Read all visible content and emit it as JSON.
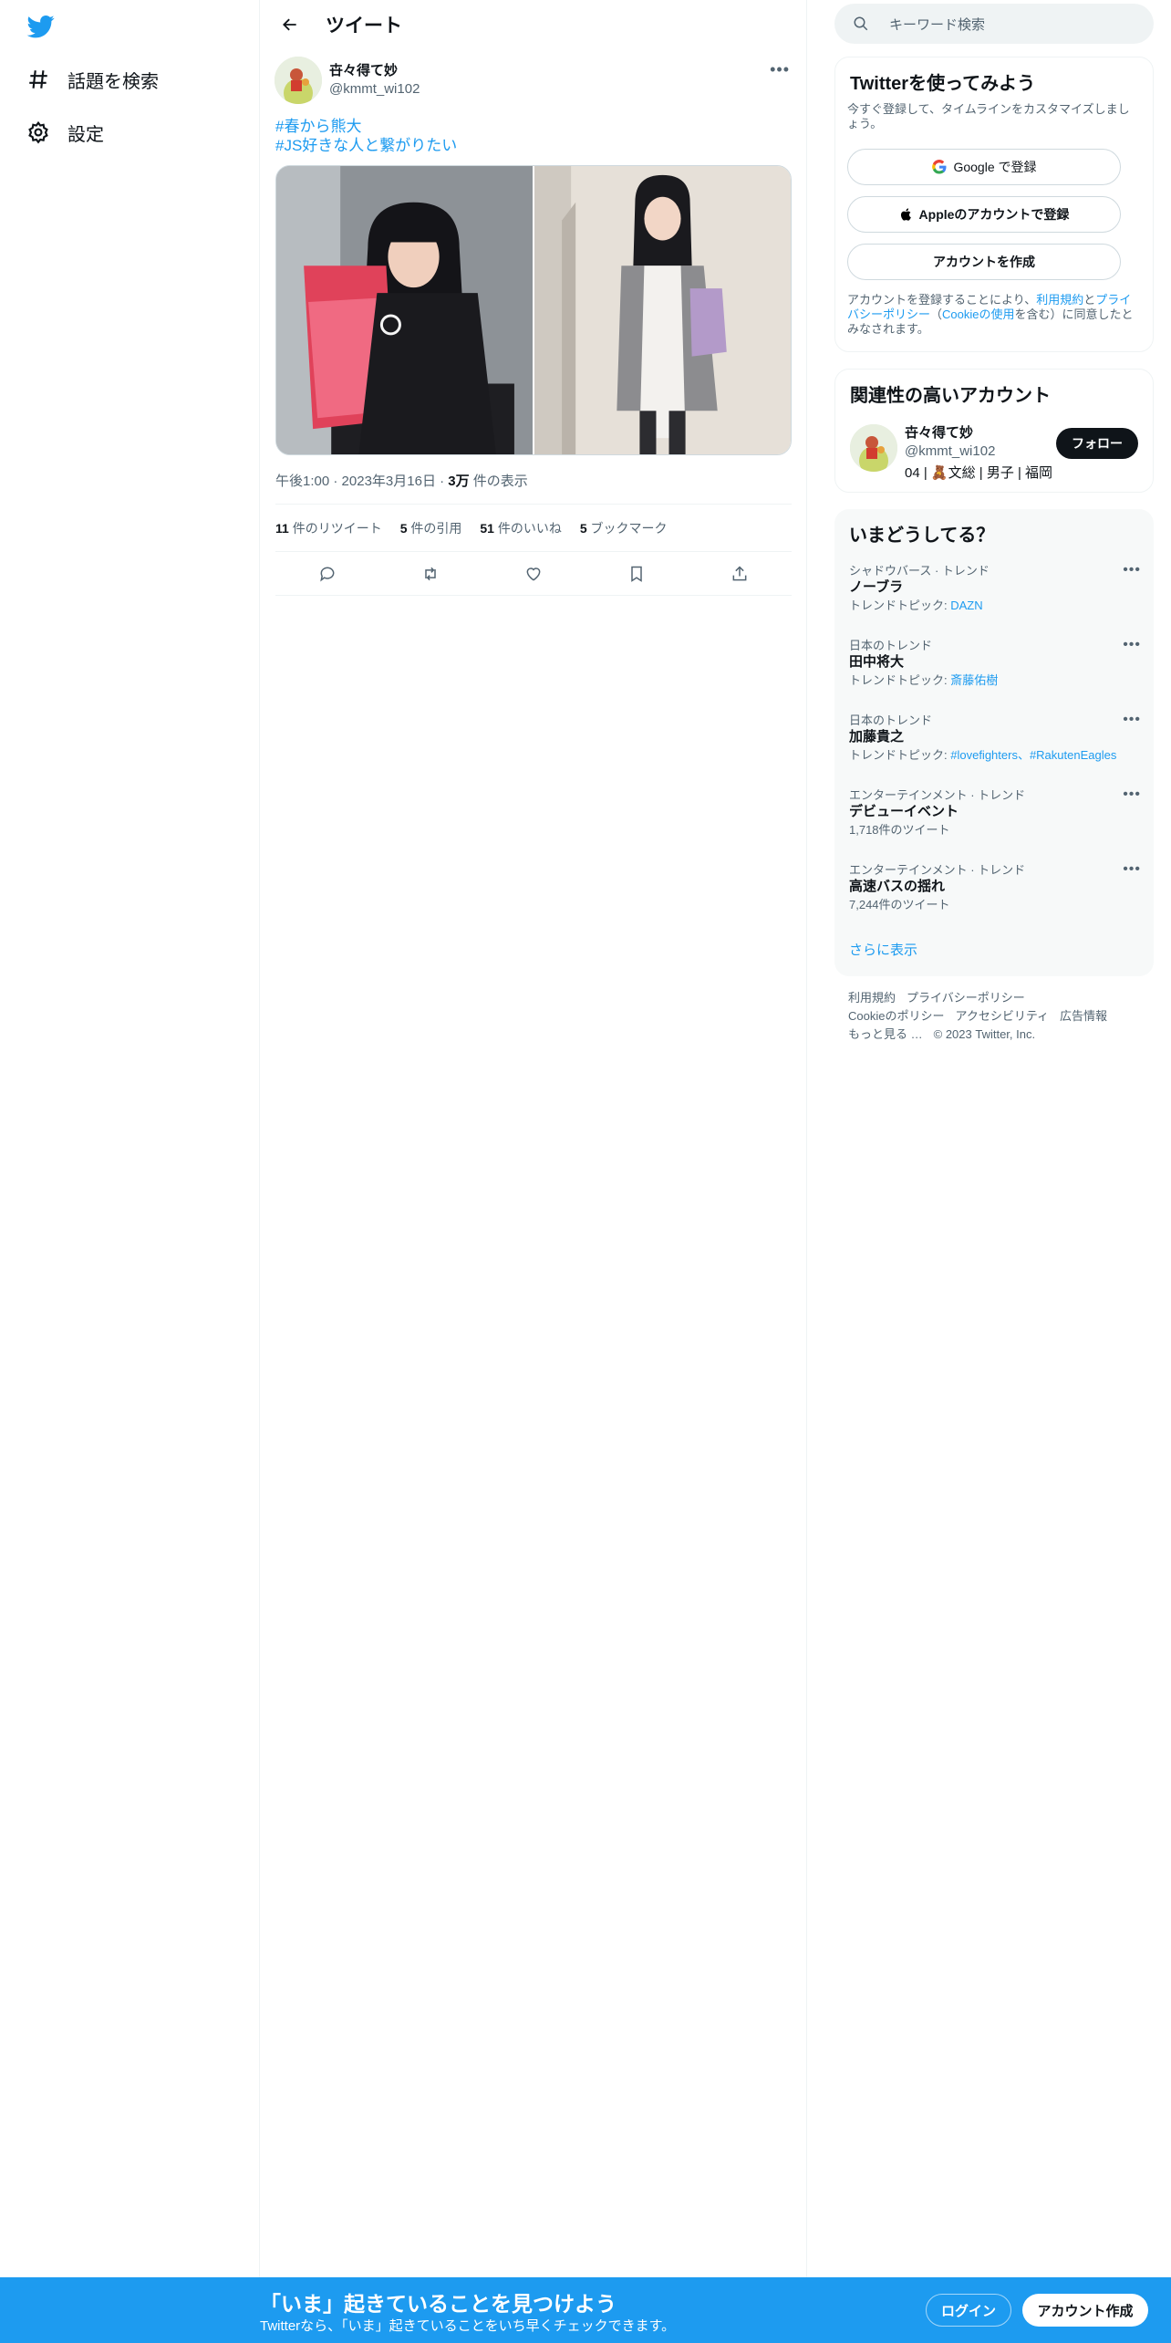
{
  "nav": {
    "logo_icon": "twitter-bird-icon",
    "items": [
      {
        "icon": "hashtag-icon",
        "label": "話題を検索"
      },
      {
        "icon": "gear-icon",
        "label": "設定"
      }
    ]
  },
  "header": {
    "title": "ツイート"
  },
  "tweet": {
    "author_name": "卋々得て妙",
    "author_handle": "@kmmt_wi102",
    "line1": "#春から熊大",
    "line2": "#JS好きな人と繋がりたい",
    "time": "午後1:00",
    "date": "2023年3月16日",
    "views_count": "3万",
    "views_label": " 件の表示",
    "retweets": "11",
    "retweets_label": " 件のリツイート",
    "quotes": "5",
    "quotes_label": " 件の引用",
    "likes": "51",
    "likes_label": " 件のいいね",
    "bookmarks": "5",
    "bookmarks_label": " ブックマーク"
  },
  "search": {
    "placeholder": "キーワード検索"
  },
  "signup": {
    "title": "Twitterを使ってみよう",
    "subtitle": "今すぐ登録して、タイムラインをカスタマイズしましょう。",
    "google": "Google で登録",
    "apple": "Appleのアカウントで登録",
    "create": "アカウントを作成",
    "legal_1": "アカウントを登録することにより、",
    "legal_terms": "利用規約",
    "legal_2": "と",
    "legal_privacy": "プライバシーポリシー",
    "legal_3": "（",
    "legal_cookie": "Cookieの使用",
    "legal_4": "を含む）に同意したとみなされます。"
  },
  "related": {
    "title": "関連性の高いアカウント",
    "name": "卋々得て妙",
    "handle": "@kmmt_wi102",
    "bio": "04 | 🧸文総 | 男子 | 福岡",
    "follow": "フォロー"
  },
  "trends": {
    "title": "いまどうしてる？",
    "items": [
      {
        "context": "シャドウバース · トレンド",
        "title": "ノーブラ",
        "topic_prefix": "トレンドトピック: ",
        "topic": "DAZN"
      },
      {
        "context": "日本のトレンド",
        "title": "田中将大",
        "topic_prefix": "トレンドトピック: ",
        "topic": "斎藤佑樹"
      },
      {
        "context": "日本のトレンド",
        "title": "加藤貴之",
        "topic_prefix": "トレンドトピック: ",
        "topic": "#lovefighters、#RakutenEagles"
      },
      {
        "context": "エンターテインメント · トレンド",
        "title": "デビューイベント",
        "topic_prefix": "",
        "topic": "",
        "count": "1,718件のツイート"
      },
      {
        "context": "エンターテインメント · トレンド",
        "title": "高速バスの揺れ",
        "topic_prefix": "",
        "topic": "",
        "count": "7,244件のツイート"
      }
    ],
    "show_more": "さらに表示"
  },
  "footer": {
    "terms": "利用規約",
    "privacy": "プライバシーポリシー",
    "cookie": "Cookieのポリシー",
    "accessibility": "アクセシビリティ",
    "ads": "広告情報",
    "more": "もっと見る …",
    "copyright": "© 2023 Twitter, Inc."
  },
  "bottom_bar": {
    "headline": "「いま」起きていることを見つけよう",
    "subline": "Twitterなら、「いま」起きていることをいち早くチェックできます。",
    "login": "ログイン",
    "signup": "アカウント作成"
  },
  "colors": {
    "accent": "#1d9bf0",
    "text": "#0f1419",
    "muted": "#536471"
  }
}
